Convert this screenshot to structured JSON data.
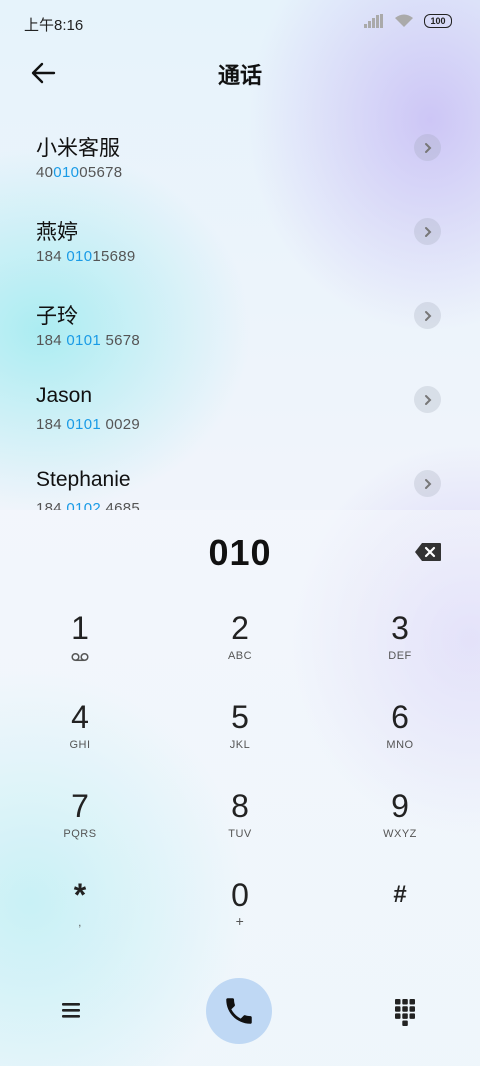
{
  "status_bar": {
    "time": "上午8:16",
    "battery": "100"
  },
  "header": {
    "title": "通话"
  },
  "contacts": [
    {
      "name": "小米客服",
      "number_pre": "40",
      "number_hl": "010",
      "number_post": "05678"
    },
    {
      "name": "燕婷",
      "number_pre": "184 ",
      "number_hl": "010",
      "number_post": "15689"
    },
    {
      "name": "子玲",
      "number_pre": "184 ",
      "number_hl": "0101",
      "number_post": " 5678"
    },
    {
      "name": "Jason",
      "number_pre": "184 ",
      "number_hl": "0101",
      "number_post": " 0029"
    },
    {
      "name": "Stephanie",
      "number_pre": "184 ",
      "number_hl": "0102",
      "number_post": " 4685"
    }
  ],
  "dialer": {
    "input": "010"
  },
  "keypad": [
    {
      "digit": "1",
      "letters": ""
    },
    {
      "digit": "2",
      "letters": "ABC"
    },
    {
      "digit": "3",
      "letters": "DEF"
    },
    {
      "digit": "4",
      "letters": "GHI"
    },
    {
      "digit": "5",
      "letters": "JKL"
    },
    {
      "digit": "6",
      "letters": "MNO"
    },
    {
      "digit": "7",
      "letters": "PQRS"
    },
    {
      "digit": "8",
      "letters": "TUV"
    },
    {
      "digit": "9",
      "letters": "WXYZ"
    },
    {
      "digit": "*",
      "letters": ","
    },
    {
      "digit": "0",
      "letters": "+"
    },
    {
      "digit": "#",
      "letters": ""
    }
  ],
  "colors": {
    "highlight": "#1a9be6",
    "call_button": "#bfd8f4"
  },
  "icons": {
    "back": "arrow-left-icon",
    "backspace": "backspace-icon",
    "voicemail": "voicemail-icon",
    "menu": "menu-icon",
    "call": "phone-icon",
    "keypad": "dialpad-icon"
  }
}
